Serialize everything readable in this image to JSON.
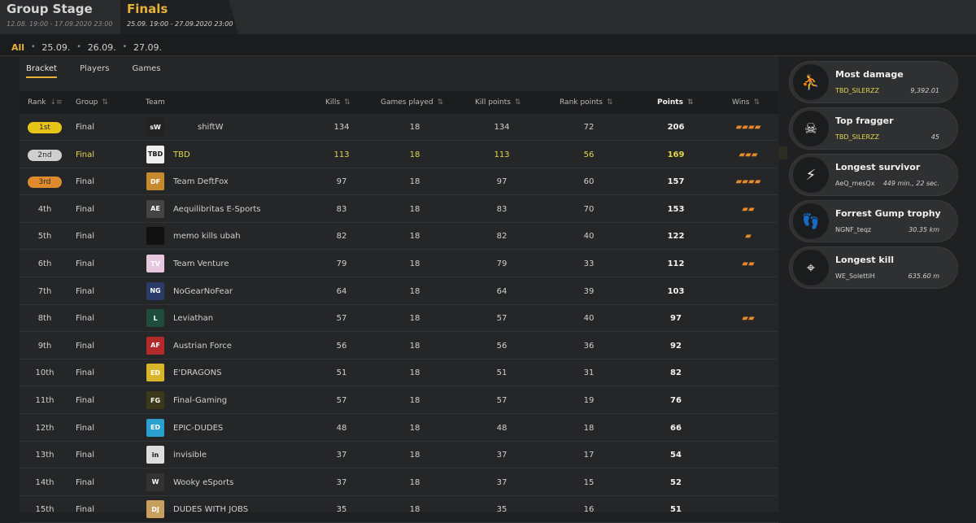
{
  "stages": [
    {
      "title": "Group Stage",
      "dates": "12.08. 19:00 - 17.09.2020 23:00"
    },
    {
      "title": "Finals",
      "dates": "25.09. 19:00 - 27.09.2020 23:00"
    }
  ],
  "date_filter": {
    "all": "All",
    "dates": [
      "25.09.",
      "26.09.",
      "27.09."
    ]
  },
  "subtabs": [
    "Bracket",
    "Players",
    "Games"
  ],
  "columns": {
    "rank": "Rank",
    "group": "Group",
    "team": "Team",
    "kills": "Kills",
    "games": "Games played",
    "kill_points": "Kill points",
    "rank_points": "Rank points",
    "points": "Points",
    "wins": "Wins"
  },
  "colors": {
    "accent": "#e8b23a",
    "gold": "#e8c418",
    "silver": "#cfcfcf",
    "bronze": "#e08a2e"
  },
  "rows": [
    {
      "rank": "1st",
      "group": "Final",
      "team": "shiftW",
      "kills": "134",
      "games": "18",
      "kp": "134",
      "rp": "72",
      "points": "206",
      "wins": 4,
      "logo": "#222",
      "logo_txt": "sW"
    },
    {
      "rank": "2nd",
      "group": "Final",
      "team": "TBD",
      "kills": "113",
      "games": "18",
      "kp": "113",
      "rp": "56",
      "points": "169",
      "wins": 3,
      "logo": "#eee",
      "logo_txt": "TBD"
    },
    {
      "rank": "3rd",
      "group": "Final",
      "team": "Team DeftFox",
      "kills": "97",
      "games": "18",
      "kp": "97",
      "rp": "60",
      "points": "157",
      "wins": 4,
      "logo": "#c58a2e",
      "logo_txt": "DF"
    },
    {
      "rank": "4th",
      "group": "Final",
      "team": "Aequilibritas E-Sports",
      "kills": "83",
      "games": "18",
      "kp": "83",
      "rp": "70",
      "points": "153",
      "wins": 2,
      "logo": "#444",
      "logo_txt": "AE"
    },
    {
      "rank": "5th",
      "group": "Final",
      "team": "memo kills ubah",
      "kills": "82",
      "games": "18",
      "kp": "82",
      "rp": "40",
      "points": "122",
      "wins": 1,
      "logo": "#111",
      "logo_txt": ""
    },
    {
      "rank": "6th",
      "group": "Final",
      "team": "Team Venture",
      "kills": "79",
      "games": "18",
      "kp": "79",
      "rp": "33",
      "points": "112",
      "wins": 2,
      "logo": "#e7c7e0",
      "logo_txt": "TV"
    },
    {
      "rank": "7th",
      "group": "Final",
      "team": "NoGearNoFear",
      "kills": "64",
      "games": "18",
      "kp": "64",
      "rp": "39",
      "points": "103",
      "wins": 0,
      "logo": "#2a3b6a",
      "logo_txt": "NG"
    },
    {
      "rank": "8th",
      "group": "Final",
      "team": "Leviathan",
      "kills": "57",
      "games": "18",
      "kp": "57",
      "rp": "40",
      "points": "97",
      "wins": 2,
      "logo": "#1e4d3e",
      "logo_txt": "L"
    },
    {
      "rank": "9th",
      "group": "Final",
      "team": "Austrian Force",
      "kills": "56",
      "games": "18",
      "kp": "56",
      "rp": "36",
      "points": "92",
      "wins": 0,
      "logo": "#b22a2a",
      "logo_txt": "AF"
    },
    {
      "rank": "10th",
      "group": "Final",
      "team": "E'DRAGONS",
      "kills": "51",
      "games": "18",
      "kp": "51",
      "rp": "31",
      "points": "82",
      "wins": 0,
      "logo": "#d9b52a",
      "logo_txt": "ED"
    },
    {
      "rank": "11th",
      "group": "Final",
      "team": "Final-Gaming",
      "kills": "57",
      "games": "18",
      "kp": "57",
      "rp": "19",
      "points": "76",
      "wins": 0,
      "logo": "#3a3a1a",
      "logo_txt": "FG"
    },
    {
      "rank": "12th",
      "group": "Final",
      "team": "EPIC-DUDES",
      "kills": "48",
      "games": "18",
      "kp": "48",
      "rp": "18",
      "points": "66",
      "wins": 0,
      "logo": "#2aa0d0",
      "logo_txt": "ED"
    },
    {
      "rank": "13th",
      "group": "Final",
      "team": "invisible",
      "kills": "37",
      "games": "18",
      "kp": "37",
      "rp": "17",
      "points": "54",
      "wins": 0,
      "logo": "#ddd",
      "logo_txt": "in"
    },
    {
      "rank": "14th",
      "group": "Final",
      "team": "Wooky eSports",
      "kills": "37",
      "games": "18",
      "kp": "37",
      "rp": "15",
      "points": "52",
      "wins": 0,
      "logo": "#333",
      "logo_txt": "W"
    },
    {
      "rank": "15th",
      "group": "Final",
      "team": "DUDES WITH JOBS",
      "kills": "35",
      "games": "18",
      "kp": "35",
      "rp": "16",
      "points": "51",
      "wins": 0,
      "logo": "#c7a060",
      "logo_txt": "DJ"
    }
  ],
  "awards": [
    {
      "title": "Most damage",
      "player": "TBD_SILERZZ",
      "value": "9,392.01",
      "icon": "prone-figure-icon",
      "glyph": "⛹",
      "gold": true
    },
    {
      "title": "Top fragger",
      "player": "TBD_SILERZZ",
      "value": "45",
      "icon": "skull-icon",
      "glyph": "☠",
      "gold": true
    },
    {
      "title": "Longest survivor",
      "player": "AeQ_mesQx",
      "value": "449 min., 22 sec.",
      "icon": "heart-lightning-icon",
      "glyph": "⚡",
      "gold": false
    },
    {
      "title": "Forrest Gump trophy",
      "player": "NGNF_teqz",
      "value": "30.35 km",
      "icon": "footprints-icon",
      "glyph": "👣",
      "gold": false
    },
    {
      "title": "Longest kill",
      "player": "WE_SolettiH",
      "value": "635.60 m",
      "icon": "sniper-rifle-icon",
      "glyph": "⌖",
      "gold": false
    }
  ]
}
